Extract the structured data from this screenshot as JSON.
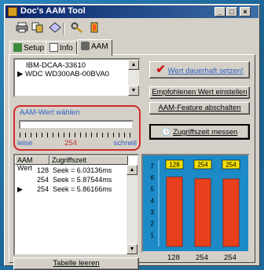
{
  "window": {
    "title": "Doc's AAM Tool",
    "minimize": "_",
    "maximize": "□",
    "close": "×"
  },
  "toolbar": {
    "icons": [
      "printer-icon",
      "copy-icon",
      "diamond-icon",
      "wrench-icon",
      "exit-icon"
    ]
  },
  "tabs": [
    {
      "label": "Setup",
      "icon": "setup-icon"
    },
    {
      "label": "Info",
      "icon": "info-icon"
    },
    {
      "label": "AAM",
      "icon": "speaker-icon"
    }
  ],
  "drives": {
    "items": [
      "IBM-DCAA-33610",
      "WDC WD300AB-00BVA0"
    ],
    "selected_index": 1
  },
  "buttons": {
    "set_permanent": "Wert dauerhaft setzen!",
    "set_recommended": "Empfohlenen Wert einstellen",
    "disable_aam": "AAM-Feature abschalten",
    "measure": "Zugriffszeit messen",
    "clear_table": "Tabelle leeren"
  },
  "aam": {
    "group_label": "AAM-Wert wählen",
    "left_label": "leise",
    "right_label": "schnell",
    "current_value": "254",
    "slider_fraction": 1.0
  },
  "table": {
    "columns": [
      "AAM Wert",
      "Zugriffszeit"
    ],
    "rows": [
      {
        "aam": "128",
        "time": "Seek = 6.03136ms"
      },
      {
        "aam": "254",
        "time": "Seek = 5.87544ms"
      },
      {
        "aam": "254",
        "time": "Seek = 5.86166ms"
      }
    ],
    "current_row": 2
  },
  "chart_data": {
    "type": "bar",
    "categories": [
      "128",
      "254",
      "254"
    ],
    "values": [
      6.03,
      5.88,
      5.86
    ],
    "data_labels": [
      "128",
      "254",
      "254"
    ],
    "yticks": [
      "1",
      "2",
      "3",
      "4",
      "5",
      "6",
      "7"
    ],
    "ylim": [
      0,
      7.5
    ],
    "bar_color": "#e8401c",
    "background_color": "#1c8ac6",
    "label_box_color": "#f5e000"
  }
}
